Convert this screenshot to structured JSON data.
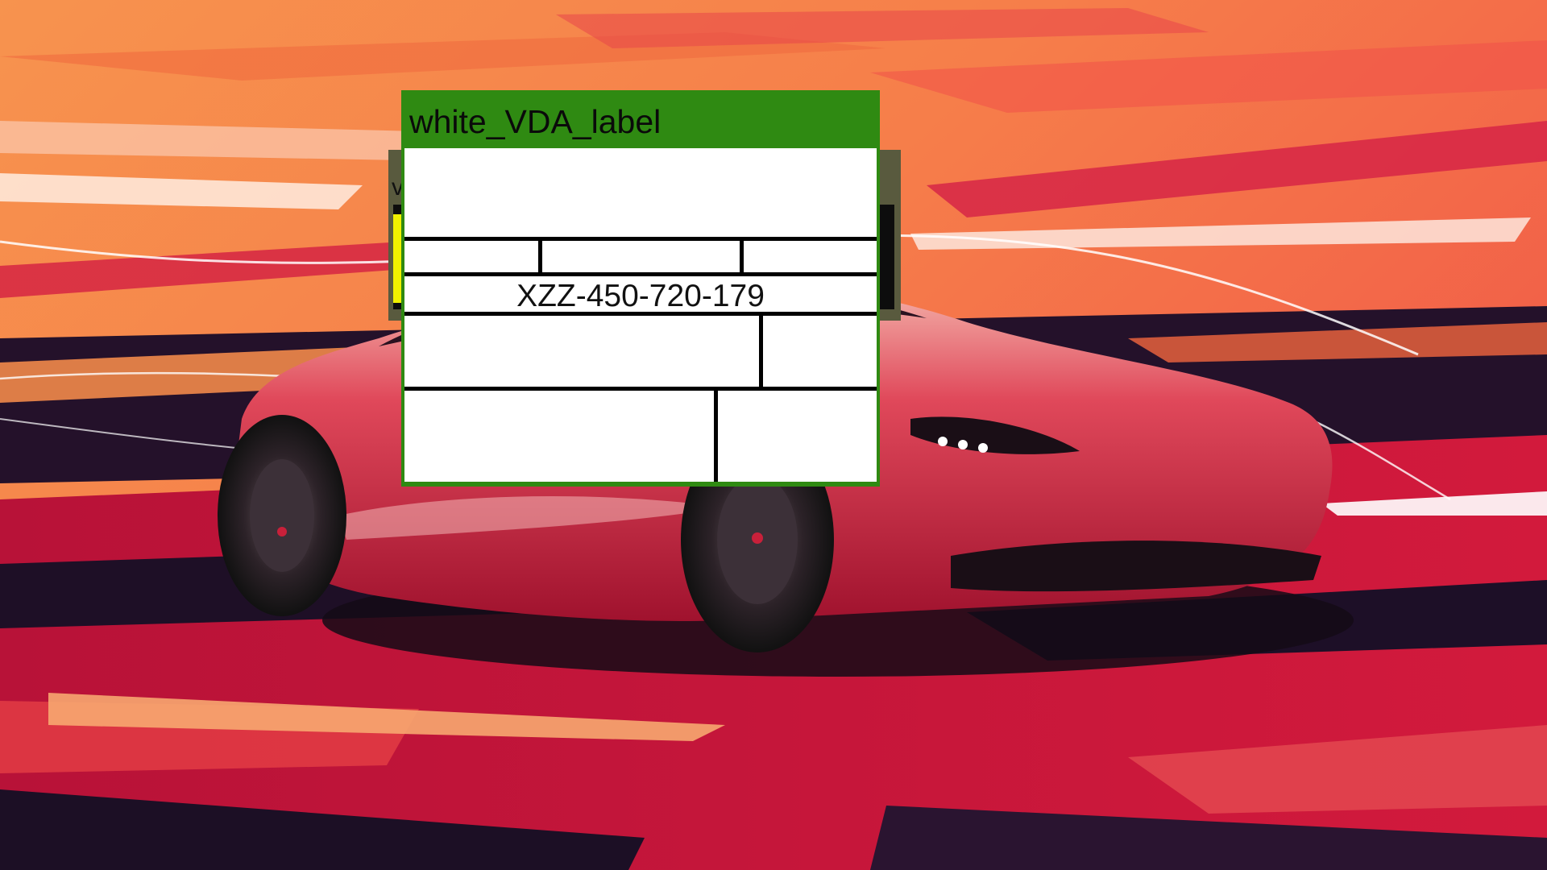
{
  "label_window": {
    "title": "white_VDA_label",
    "code": "XZZ-450-720-179",
    "title_bar_color": "#2f8a12"
  },
  "back_window": {
    "visible_letter": "v"
  },
  "wallpaper": {
    "subject": "red sports car on stylized orange-red road",
    "colors": {
      "sky_top": "#f78a4c",
      "sky_mid": "#f26a4a",
      "road": "#c8143c",
      "shadow": "#1b0f24",
      "car_body": "#d9374a"
    }
  }
}
